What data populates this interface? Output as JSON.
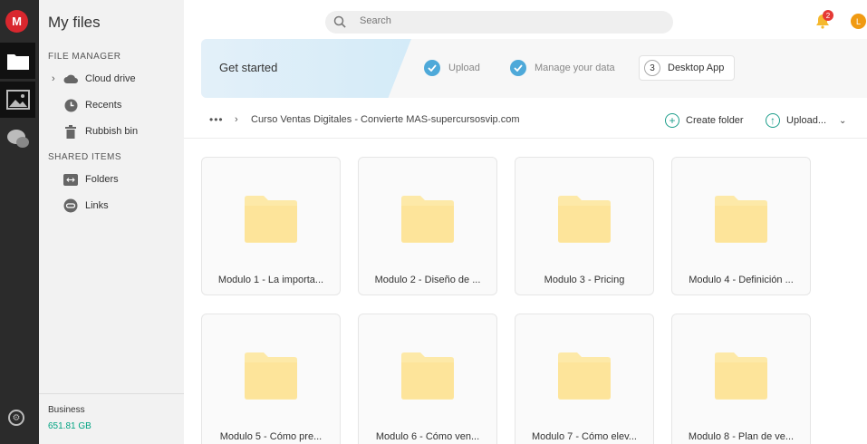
{
  "rail": {
    "logo_letter": "M"
  },
  "sidebar": {
    "title": "My files",
    "section_file_manager": "FILE MANAGER",
    "cloud_drive": "Cloud drive",
    "recents": "Recents",
    "rubbish_bin": "Rubbish bin",
    "section_shared": "SHARED ITEMS",
    "folders": "Folders",
    "links": "Links",
    "plan": "Business",
    "usage": "651.81 GB"
  },
  "header": {
    "search_placeholder": "Search",
    "notification_count": "2",
    "avatar_letter": "L"
  },
  "banner": {
    "title": "Get started",
    "step1": "Upload",
    "step2": "Manage your data",
    "step3_num": "3",
    "step3": "Desktop App"
  },
  "toolbar": {
    "dots": "•••",
    "breadcrumb": "Curso Ventas Digitales - Convierte MAS-supercursosvip.com",
    "create_folder": "Create folder",
    "upload": "Upload..."
  },
  "folders": [
    "Modulo 1 - La importa...",
    "Modulo 2 - Diseño de ...",
    "Modulo 3 - Pricing",
    "Modulo 4 - Definición ...",
    "Modulo 5 - Cómo pre...",
    "Modulo 6 - Cómo ven...",
    "Modulo 7 - Cómo elev...",
    "Modulo 8 - Plan de ve..."
  ],
  "colors": {
    "accent": "#00a382",
    "brand": "#d9272e",
    "folder": "#fde9a8",
    "check": "#4ea9d9"
  }
}
